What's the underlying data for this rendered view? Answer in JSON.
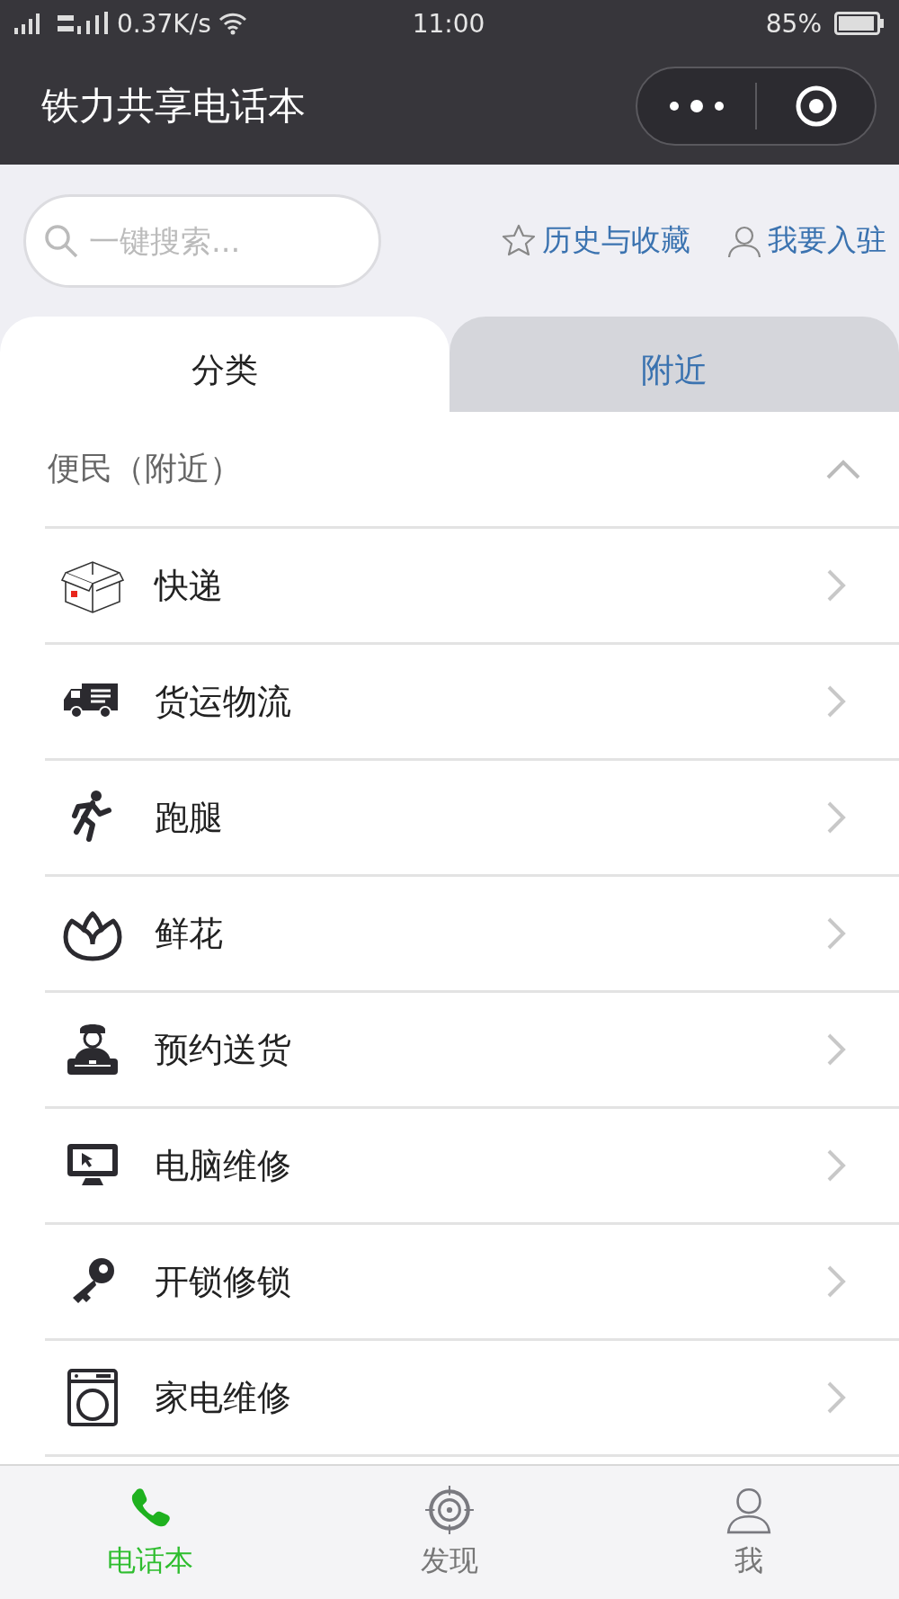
{
  "status_bar": {
    "network_speed": "0.37K/s",
    "time": "11:00",
    "battery": "85%"
  },
  "header": {
    "title": "铁力共享电话本"
  },
  "search": {
    "placeholder": "一键搜索..."
  },
  "links": [
    {
      "label": "历史与收藏",
      "kind": "star"
    },
    {
      "label": "我要入驻",
      "kind": "person"
    }
  ],
  "tabs": [
    {
      "label": "分类",
      "selected": true
    },
    {
      "label": "附近",
      "selected": false
    }
  ],
  "section": {
    "title": "便民（附近）",
    "expanded": true,
    "items": [
      {
        "label": "快递",
        "kind": "box"
      },
      {
        "label": "货运物流",
        "kind": "truck"
      },
      {
        "label": "跑腿",
        "kind": "runner"
      },
      {
        "label": "鲜花",
        "kind": "flower"
      },
      {
        "label": "预约送货",
        "kind": "courier"
      },
      {
        "label": "电脑维修",
        "kind": "monitor"
      },
      {
        "label": "开锁修锁",
        "kind": "key"
      },
      {
        "label": "家电维修",
        "kind": "appliance"
      }
    ]
  },
  "bottom_nav": [
    {
      "label": "电话本",
      "kind": "phone",
      "selected": true
    },
    {
      "label": "发现",
      "kind": "target",
      "selected": false
    },
    {
      "label": "我",
      "kind": "person",
      "selected": false
    }
  ]
}
